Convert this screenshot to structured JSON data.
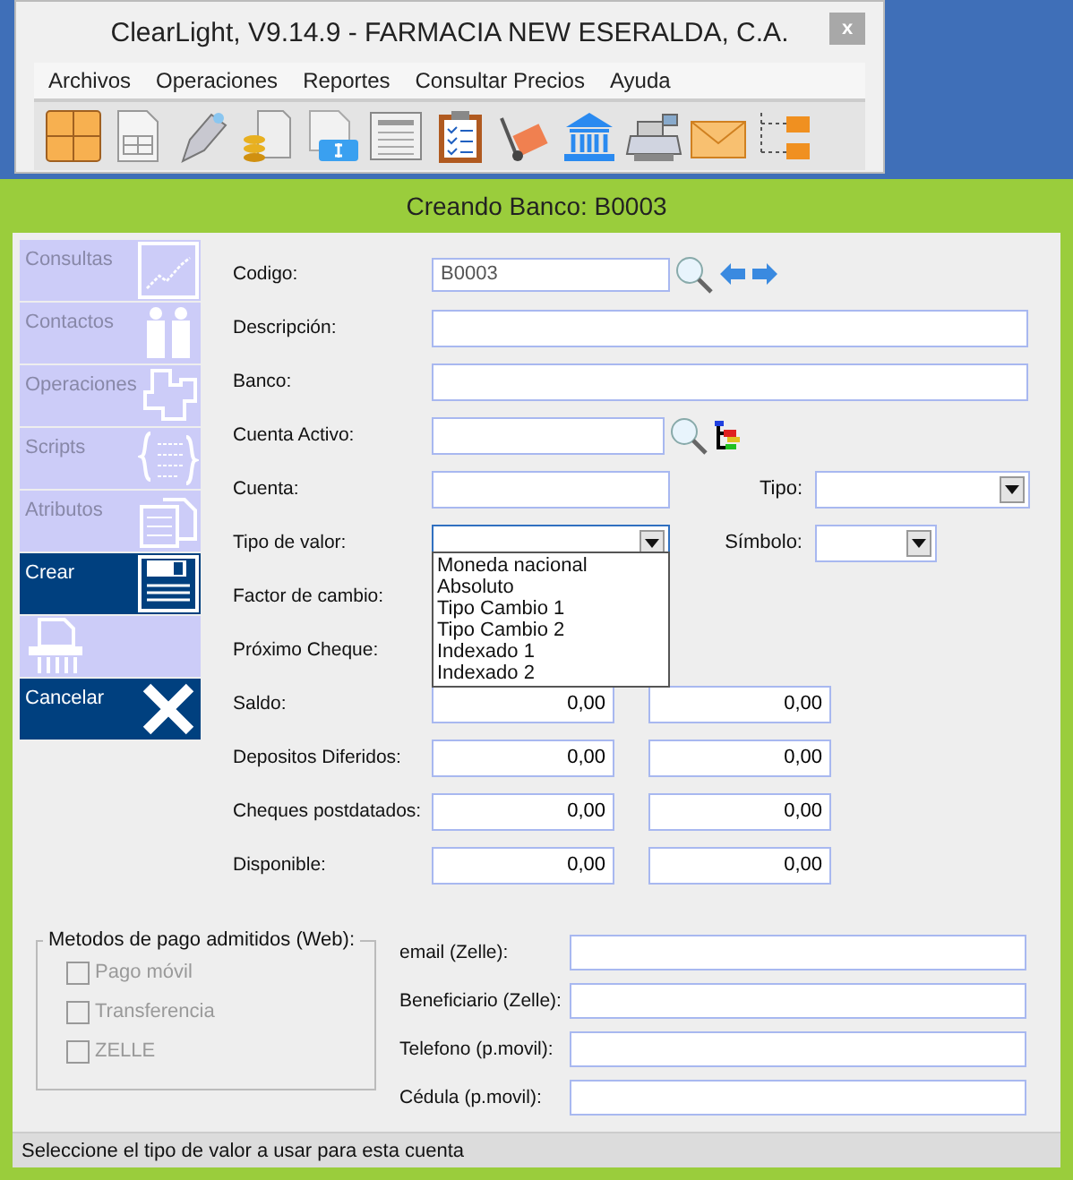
{
  "app_window": {
    "title": "ClearLight, V9.14.9 - FARMACIA NEW ESERALDA, C.A.",
    "close": "x",
    "menu": [
      "Archivos",
      "Operaciones",
      "Reportes",
      "Consultar Precios",
      "Ayuda"
    ]
  },
  "dialog": {
    "title": "Creando Banco: B0003",
    "sidebar": [
      {
        "label": "Consultas",
        "disabled": true
      },
      {
        "label": "Contactos",
        "disabled": true
      },
      {
        "label": "Operaciones",
        "disabled": true
      },
      {
        "label": "Scripts",
        "disabled": true
      },
      {
        "label": "Atributos",
        "disabled": true
      },
      {
        "label": "Crear",
        "disabled": false
      },
      {
        "disabled": true
      },
      {
        "label": "Cancelar",
        "disabled": false
      }
    ],
    "rows": [
      {
        "kind": "code",
        "label": "Codigo:",
        "value": "B0003"
      },
      {
        "kind": "wide",
        "label": "Descripción:"
      },
      {
        "kind": "wide",
        "label": "Banco:"
      },
      {
        "kind": "account",
        "label": "Cuenta Activo:"
      },
      {
        "kind": "pair",
        "label": "Cuenta:",
        "side_label": "Tipo:"
      },
      {
        "kind": "combo",
        "label": "Tipo de valor:",
        "side_label": "Símbolo:",
        "expanded": true,
        "options": [
          "Moneda nacional",
          "Absoluto",
          "Tipo Cambio 1",
          "Tipo Cambio 2",
          "Indexado 1",
          "Indexado 2"
        ]
      },
      {
        "kind": "covered",
        "label": "Factor de cambio:"
      },
      {
        "kind": "covered",
        "label": "Próximo Cheque:"
      },
      {
        "kind": "amounts",
        "label": "Saldo:",
        "values": [
          "0,00",
          "0,00"
        ]
      },
      {
        "kind": "amounts",
        "label": "Depositos Diferidos:",
        "values": [
          "0,00",
          "0,00"
        ]
      },
      {
        "kind": "amounts",
        "label": "Cheques postdatados:",
        "values": [
          "0,00",
          "0,00"
        ]
      },
      {
        "kind": "amounts",
        "label": "Disponible:",
        "values": [
          "0,00",
          "0,00"
        ]
      }
    ],
    "payment_methods": {
      "title": "Metodos de pago admitidos (Web):",
      "options": [
        {
          "label": "Pago móvil",
          "checked": false,
          "disabled": true
        },
        {
          "label": "Transferencia",
          "checked": false,
          "disabled": true
        },
        {
          "label": "ZELLE",
          "checked": false,
          "disabled": true
        }
      ]
    },
    "contact_fields": [
      "email (Zelle):",
      "Beneficiario (Zelle):",
      "Telefono (p.movil):",
      "Cédula (p.movil):"
    ],
    "status_bar": "Seleccione el tipo de valor a usar para esta cuenta"
  }
}
